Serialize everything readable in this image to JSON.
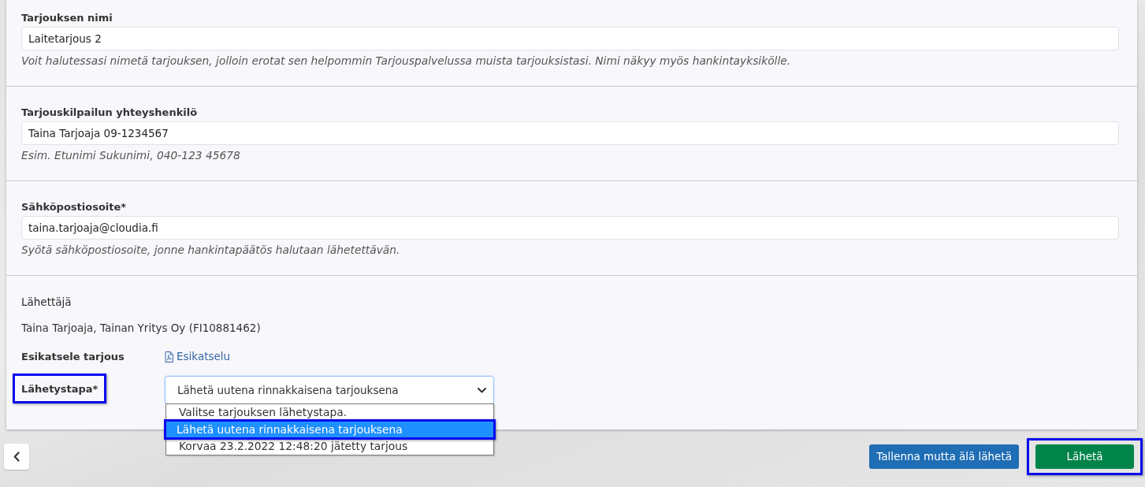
{
  "fields": [
    {
      "kind": "text",
      "label": "Tarjouksen nimi",
      "value": "Laitetarjous 2",
      "help": "Voit halutessasi nimetä tarjouksen, jolloin erotat sen helpommin Tarjouspalvelussa muista tarjouksistasi. Nimi näkyy myös hankintayksikölle."
    },
    {
      "kind": "text",
      "label": "Tarjouskilpailun yhteyshenkilö",
      "value": "Taina Tarjoaja 09-1234567",
      "help": "Esim. Etunimi Sukunimi, 040-123 45678"
    },
    {
      "kind": "text",
      "label": "Sähköpostiosoite*",
      "value": "taina.tarjoaja@cloudia.fi",
      "help": "Syötä sähköpostiosoite, jonne hankintapäätös halutaan lähetettävän."
    }
  ],
  "sender": {
    "label": "Lähettäjä",
    "value": "Taina Tarjoaja, Tainan Yritys Oy (FI10881462)"
  },
  "preview": {
    "label": "Esikatsele tarjous",
    "link": "Esikatselu"
  },
  "send_method": {
    "label": "Lähetystapa*",
    "highlighted": true,
    "value": "Lähetä uutena rinnakkaisena tarjouksena",
    "expanded": true,
    "options": [
      {
        "label": "Valitse tarjouksen lähetystapa.",
        "selected": false,
        "highlighted": false
      },
      {
        "label": "Lähetä uutena rinnakkaisena tarjouksena",
        "selected": true,
        "highlighted": true
      },
      {
        "label": "Korvaa 23.2.2022 12:48:20 jätetty tarjous",
        "selected": false,
        "highlighted": false
      }
    ]
  },
  "buttons": [
    {
      "kind": "primary",
      "label": "Tallenna mutta älä lähetä",
      "highlighted": false
    },
    {
      "kind": "success",
      "label": "Lähetä",
      "highlighted": true
    }
  ]
}
